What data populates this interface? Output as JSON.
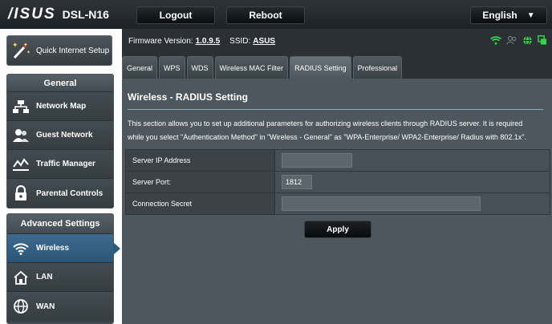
{
  "brand": {
    "logo": "/ISUS",
    "model": "DSL-N16"
  },
  "topbar": {
    "logout": "Logout",
    "reboot": "Reboot",
    "language": "English"
  },
  "sidebar": {
    "quick_setup": "Quick Internet Setup",
    "general_title": "General",
    "general_items": [
      {
        "label": "Network Map",
        "icon": "network-map-icon"
      },
      {
        "label": "Guest Network",
        "icon": "guest-network-icon"
      },
      {
        "label": "Traffic Manager",
        "icon": "traffic-manager-icon"
      },
      {
        "label": "Parental Controls",
        "icon": "lock-icon"
      }
    ],
    "advanced_title": "Advanced Settings",
    "advanced_items": [
      {
        "label": "Wireless",
        "icon": "wifi-icon",
        "active": true
      },
      {
        "label": "LAN",
        "icon": "home-icon"
      },
      {
        "label": "WAN",
        "icon": "globe-icon"
      }
    ]
  },
  "info": {
    "firmware_label": "Firmware Version:",
    "firmware_value": "1.0.9.5",
    "ssid_label": "SSID:",
    "ssid_value": "ASUS"
  },
  "tabs": [
    "General",
    "WPS",
    "WDS",
    "Wireless MAC Filter",
    "RADIUS Setting",
    "Professional"
  ],
  "active_tab": "RADIUS Setting",
  "section": {
    "title": "Wireless - RADIUS Setting",
    "desc_line1": "This section allows you to set up additional parameters for authorizing wireless clients through RADIUS server. It is required",
    "desc_line2": "while you select \"Authentication Method\" in \"Wireless - General\" as \"WPA-Enterprise/ WPA2-Enterprise/ Radius with 802.1x\"."
  },
  "form": {
    "server_ip_label": "Server IP Address",
    "server_ip_value": "",
    "server_port_label": "Server Port:",
    "server_port_value": "1812",
    "secret_label": "Connection Secret",
    "secret_value": ""
  },
  "apply_label": "Apply",
  "colors": {
    "accent_blue": "#2a5576",
    "status_green": "#38d34a"
  }
}
